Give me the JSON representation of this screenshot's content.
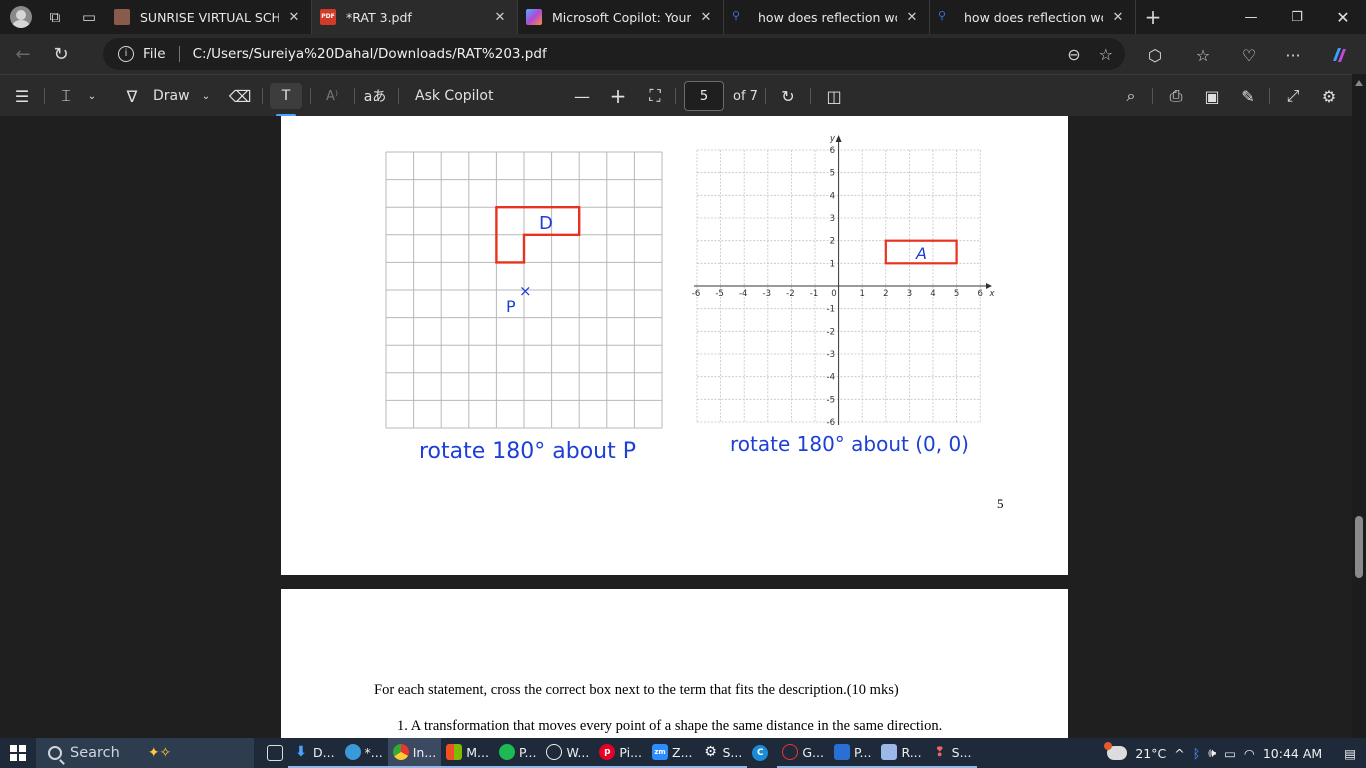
{
  "browser": {
    "tabs": [
      {
        "title": "SUNRISE VIRTUAL SCHOOL",
        "favicon_color": "#8a5a4a"
      },
      {
        "title": "*RAT 3.pdf",
        "favicon_color": "#d23a2a",
        "favicon_text": "PDF"
      },
      {
        "title": "Microsoft Copilot: Your AI c",
        "favicon_color": "#7a5cd6"
      },
      {
        "title": "how does reflection work ir",
        "favicon_color": "#3a6fd6"
      },
      {
        "title": "how does reflection work ir",
        "favicon_color": "#3a6fd6"
      }
    ],
    "address": {
      "scheme_label": "File",
      "url": "C:/Users/Sureiya%20Dahal/Downloads/RAT%203.pdf"
    }
  },
  "pdf_toolbar": {
    "draw_label": "Draw",
    "ask_copilot_label": "Ask Copilot",
    "page_current": "5",
    "page_total": "of 7"
  },
  "page5": {
    "left_caption": "rotate 180° about P",
    "right_caption": "rotate 180° about (0, 0)",
    "shape_d_label": "D",
    "shape_a_label": "A",
    "point_label": "P",
    "point_marker": "×",
    "page_number": "5",
    "axis_x_label": "x",
    "axis_y_label": "y",
    "x_ticks": [
      "-6",
      "-5",
      "-4",
      "-3",
      "-2",
      "-1",
      "0",
      "1",
      "2",
      "3",
      "4",
      "5",
      "6"
    ],
    "y_ticks": [
      "6",
      "5",
      "4",
      "3",
      "2",
      "1",
      "-1",
      "-2",
      "-3",
      "-4",
      "-5",
      "-6"
    ]
  },
  "page6": {
    "instruction": "For each statement, cross the correct box next to the term that fits the description.(10 mks)",
    "item_1": "1.   A transformation that moves every point of a shape the same distance in the same direction."
  },
  "taskbar": {
    "search_label": "Search",
    "items": [
      "D...",
      "*...",
      "In...",
      "M...",
      "P...",
      "W...",
      "Pi...",
      "Z...",
      "S...",
      "",
      "G...",
      "P...",
      "R...",
      "S..."
    ],
    "temperature": "21°C",
    "time": "10:44 AM"
  },
  "colors": {
    "shape_red": "#e8321f",
    "caption_blue": "#1d3fd6",
    "accent": "#4aa3ff"
  }
}
